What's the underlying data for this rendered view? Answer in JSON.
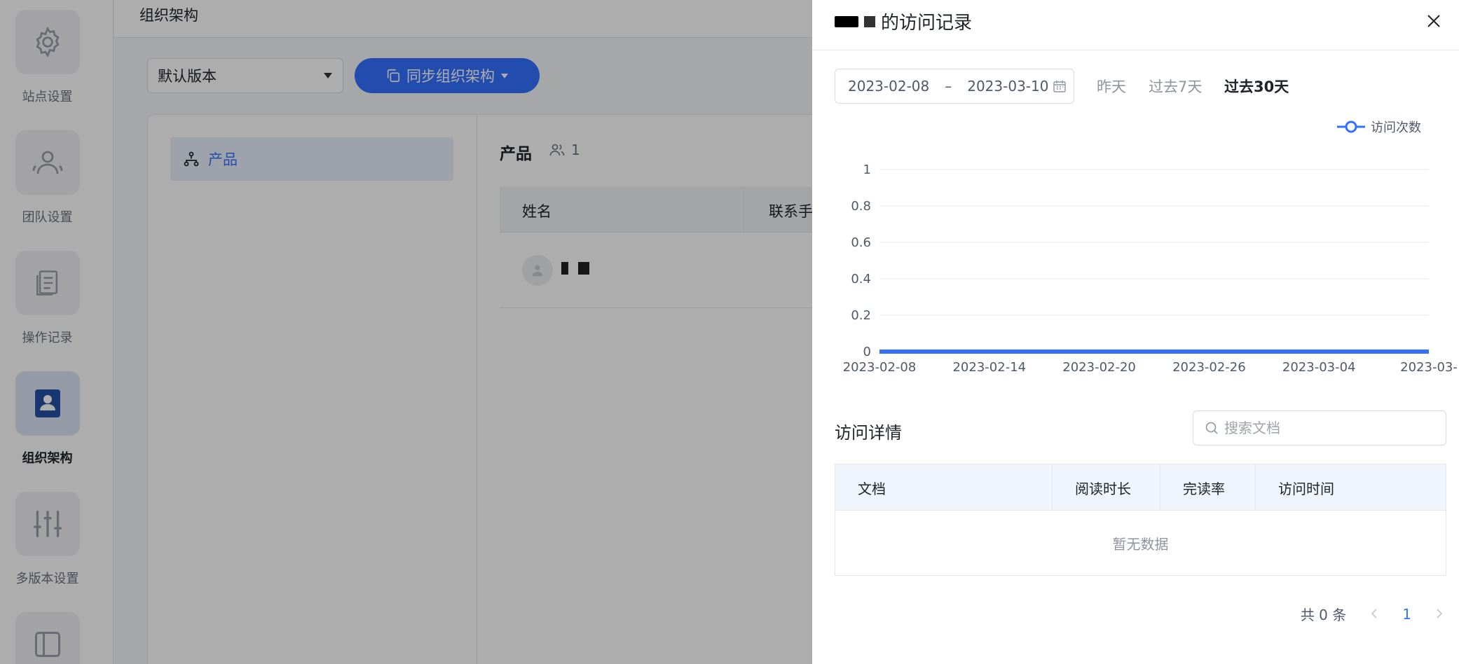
{
  "rail": {
    "items": [
      {
        "label": "站点设置",
        "icon": "gear-icon"
      },
      {
        "label": "团队设置",
        "icon": "team-icon"
      },
      {
        "label": "操作记录",
        "icon": "document-icon"
      },
      {
        "label": "组织架构",
        "icon": "contact-book-icon",
        "active": true
      },
      {
        "label": "多版本设置",
        "icon": "sliders-icon"
      }
    ]
  },
  "topbar": {
    "title": "组织架构"
  },
  "toolbar": {
    "version": "默认版本",
    "sync_label": "同步组织架构"
  },
  "org": {
    "node_label": "产品"
  },
  "members": {
    "dept_title": "产品",
    "count": "1",
    "columns": [
      "姓名",
      "联系手"
    ]
  },
  "drawer": {
    "title_suffix": "的访问记录",
    "date_start": "2023-02-08",
    "date_sep": "–",
    "date_end": "2023-03-10",
    "quick_options": [
      "昨天",
      "过去7天",
      "过去30天"
    ],
    "quick_active": "过去30天",
    "legend_label": "访问次数",
    "detail_title": "访问详情",
    "search_placeholder": "搜索文档",
    "table_columns": [
      "文档",
      "阅读时长",
      "完读率",
      "访问时间"
    ],
    "empty_text": "暂无数据",
    "pager_total": "共 0 条",
    "pager_page": "1"
  },
  "colors": {
    "accent": "#3370ff",
    "line": "#3370ff"
  },
  "chart_data": {
    "type": "line",
    "series": [
      {
        "name": "访问次数",
        "x": [
          "2023-02-08",
          "2023-02-09",
          "2023-02-10",
          "2023-02-11",
          "2023-02-12",
          "2023-02-13",
          "2023-02-14",
          "2023-02-15",
          "2023-02-16",
          "2023-02-17",
          "2023-02-18",
          "2023-02-19",
          "2023-02-20",
          "2023-02-21",
          "2023-02-22",
          "2023-02-23",
          "2023-02-24",
          "2023-02-25",
          "2023-02-26",
          "2023-02-27",
          "2023-02-28",
          "2023-03-01",
          "2023-03-02",
          "2023-03-03",
          "2023-03-04",
          "2023-03-05",
          "2023-03-06",
          "2023-03-07",
          "2023-03-08",
          "2023-03-09",
          "2023-03-10"
        ],
        "values": [
          0,
          0,
          0,
          0,
          0,
          0,
          0,
          0,
          0,
          0,
          0,
          0,
          0,
          0,
          0,
          0,
          0,
          0,
          0,
          0,
          0,
          0,
          0,
          0,
          0,
          0,
          0,
          0,
          0,
          0,
          0
        ]
      }
    ],
    "x_tick_labels": [
      "2023-02-08",
      "2023-02-14",
      "2023-02-20",
      "2023-02-26",
      "2023-03-04",
      "2023-03-"
    ],
    "y_ticks": [
      0,
      0.2,
      0.4,
      0.6,
      0.8,
      1
    ],
    "ylim": [
      0,
      1
    ],
    "grid": true,
    "legend_position": "top-right"
  }
}
